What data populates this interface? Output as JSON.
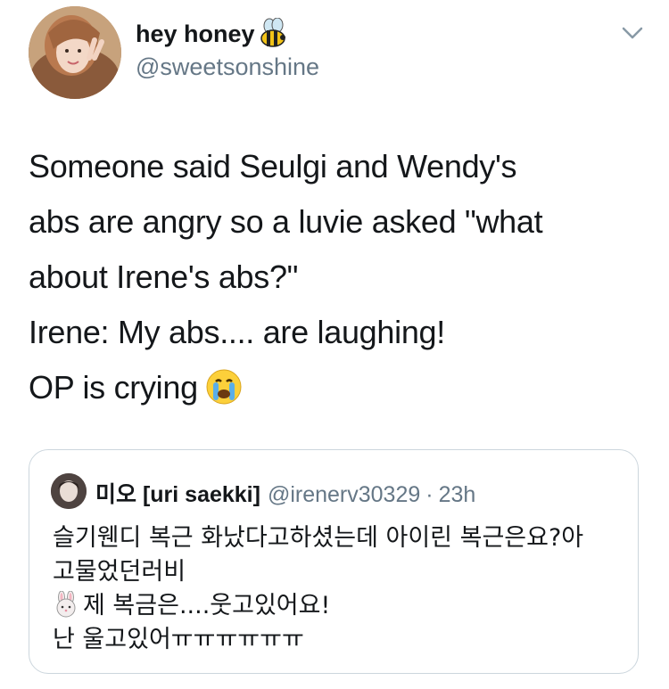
{
  "author": {
    "display_name": "hey honey",
    "display_name_emoji": "bee-emoji",
    "handle": "@sweetsonshine"
  },
  "tweet": {
    "lines": [
      "Someone said Seulgi and Wendy's",
      "abs are angry so a luvie asked \"what",
      "about Irene's abs?\"",
      "Irene: My abs.... are laughing!",
      "OP is crying"
    ],
    "trailing_emoji": "crying-face-emoji"
  },
  "quoted_tweet": {
    "display_name": "미오 [uri saekki]",
    "handle": "@irenerv30329",
    "separator": "·",
    "time": "23h",
    "lines": [
      "슬기웬디 복근 화났다고하셨는데 아이린 복근은요?아",
      "고물었던러비",
      "제 복금은....웃고있어요!",
      "난 울고있어ㅠㅠㅠㅠㅠㅠ"
    ],
    "line3_emoji": "rabbit-emoji"
  },
  "icons": {
    "menu": "chevron-down-icon"
  }
}
